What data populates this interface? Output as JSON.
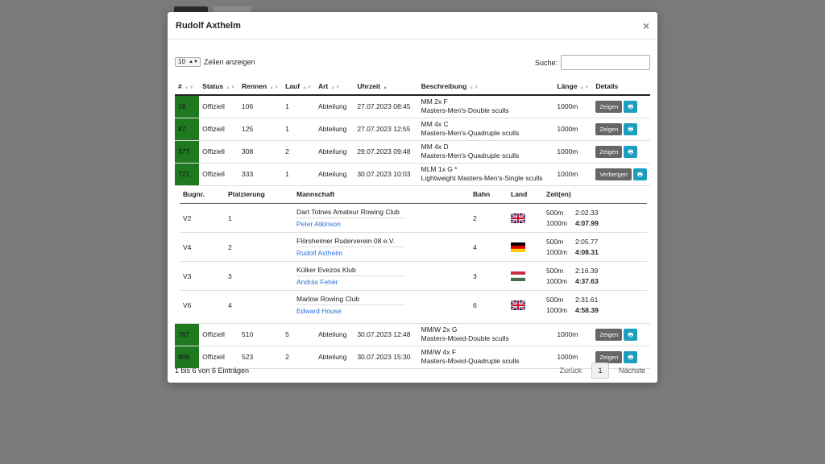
{
  "modal": {
    "title": "Rudolf Axthelm",
    "close": "×"
  },
  "controls": {
    "length_value": "10",
    "length_label": "Zeilen anzeigen",
    "search_label": "Suche:",
    "search_value": ""
  },
  "columns": [
    "#",
    "Status",
    "Rennen",
    "Lauf",
    "Art",
    "Uhrzeit",
    "Beschreibung",
    "Länge",
    "Details"
  ],
  "rows": [
    {
      "num": "16",
      "status": "Offiziell",
      "race": "106",
      "heat": "1",
      "type": "Abteilung",
      "time": "27.07.2023 08:45",
      "desc1": "MM 2x F",
      "desc2": "Masters-Men's-Double sculls",
      "length": "1000m",
      "btn": "Zeigen"
    },
    {
      "num": "87",
      "status": "Offiziell",
      "race": "125",
      "heat": "1",
      "type": "Abteilung",
      "time": "27.07.2023 12:55",
      "desc1": "MM 4x C",
      "desc2": "Masters-Men's-Quadruple sculls",
      "length": "1000m",
      "btn": "Zeigen"
    },
    {
      "num": "377",
      "status": "Offiziell",
      "race": "308",
      "heat": "2",
      "type": "Abteilung",
      "time": "29.07.2023 09:48",
      "desc1": "MM 4x D",
      "desc2": "Masters-Men's-Quadruple sculls",
      "length": "1000m",
      "btn": "Zeigen"
    },
    {
      "num": "721",
      "status": "Offiziell",
      "race": "333",
      "heat": "1",
      "type": "Abteilung",
      "time": "30.07.2023 10:03",
      "desc1": "MLM 1x G *",
      "desc2": "Lightweight Masters-Men's-Single sculls",
      "length": "1000m",
      "btn": "Verbergen"
    },
    {
      "num": "767",
      "status": "Offiziell",
      "race": "510",
      "heat": "5",
      "type": "Abteilung",
      "time": "30.07.2023 12:48",
      "desc1": "MM/W 2x G",
      "desc2": "Masters-Mixed-Double sculls",
      "length": "1000m",
      "btn": "Zeigen"
    },
    {
      "num": "806",
      "status": "Offiziell",
      "race": "523",
      "heat": "2",
      "type": "Abteilung",
      "time": "30.07.2023 15:30",
      "desc1": "MM/W 4x F",
      "desc2": "Masters-Mixed-Quadruple sculls",
      "length": "1000m",
      "btn": "Zeigen"
    }
  ],
  "detail": {
    "columns": [
      "Bugnr.",
      "Platzierung",
      "Mannschaft",
      "Bahn",
      "Land",
      "Zeit(en)"
    ],
    "entries": [
      {
        "bow": "V2",
        "place": "1",
        "team": "Dart Totnes Amateur Rowing Club",
        "rower": "Peter Atkinson",
        "lane": "2",
        "flag": "gb-flag-icon",
        "d1": "500m",
        "t1": "2:02.33",
        "d2": "1000m",
        "t2": "4:07.99"
      },
      {
        "bow": "V4",
        "place": "2",
        "team": "Flörsheimer Ruderverein 08 e.V.",
        "rower": "Rudolf Axthelm",
        "lane": "4",
        "flag": "de-flag-icon",
        "d1": "500m",
        "t1": "2:05.77",
        "d2": "1000m",
        "t2": "4:08.31"
      },
      {
        "bow": "V3",
        "place": "3",
        "team": "Külker Evezos Klub",
        "rower": "András Fehér",
        "lane": "3",
        "flag": "hu-flag-icon",
        "d1": "500m",
        "t1": "2:16.39",
        "d2": "1000m",
        "t2": "4:37.63"
      },
      {
        "bow": "V6",
        "place": "4",
        "team": "Marlow Rowing Club",
        "rower": "Edward House",
        "lane": "6",
        "flag": "gb-flag-icon",
        "d1": "500m",
        "t1": "2:31.61",
        "d2": "1000m",
        "t2": "4:58.39"
      }
    ]
  },
  "footer": {
    "info": "1 bis 6 von 6 Einträgen",
    "prev": "Zurück",
    "page": "1",
    "next": "Nächste"
  },
  "colors": {
    "bug_cell": "#1f7a1f",
    "print_btn": "#1c9ebf",
    "show_btn": "#666666",
    "link": "#2a6fd6"
  }
}
